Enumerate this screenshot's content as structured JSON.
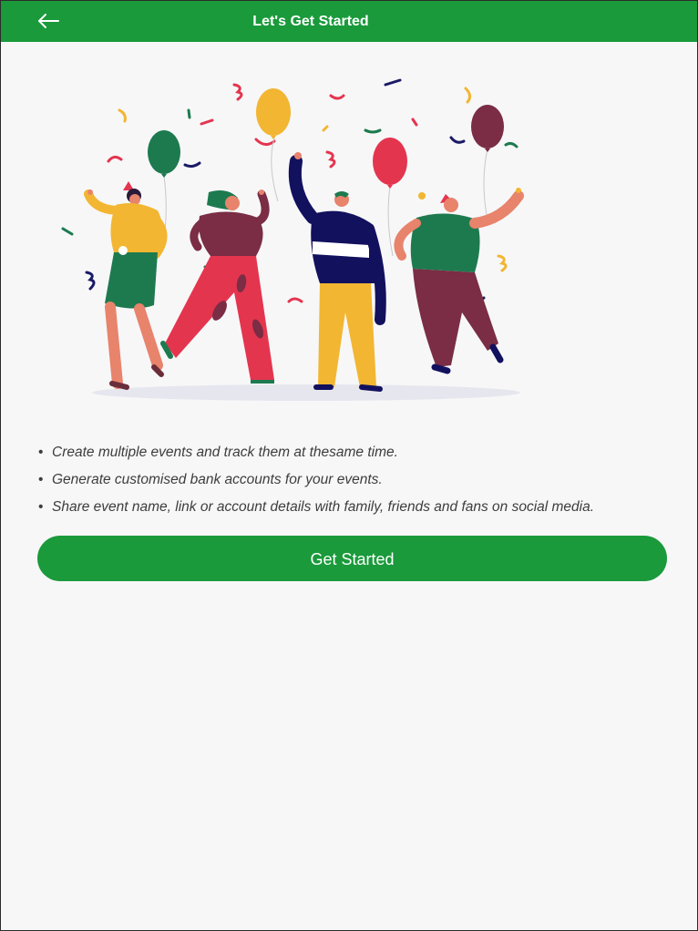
{
  "header": {
    "title": "Let's Get Started",
    "back_icon": "arrow-left-icon"
  },
  "illustration": {
    "description_icon": "party-celebration-illustration"
  },
  "features": [
    {
      "bullet": "•",
      "text": "Create multiple events and track them at thesame time."
    },
    {
      "bullet": "•",
      "text": "Generate customised bank accounts for your events."
    },
    {
      "bullet": "•",
      "text": "Share event name, link or account details with family, friends and fans on social media."
    }
  ],
  "cta": {
    "label": "Get Started"
  },
  "colors": {
    "brand_green": "#1a9a3b",
    "background": "#f7f7f8",
    "text": "#3d3d3d"
  }
}
